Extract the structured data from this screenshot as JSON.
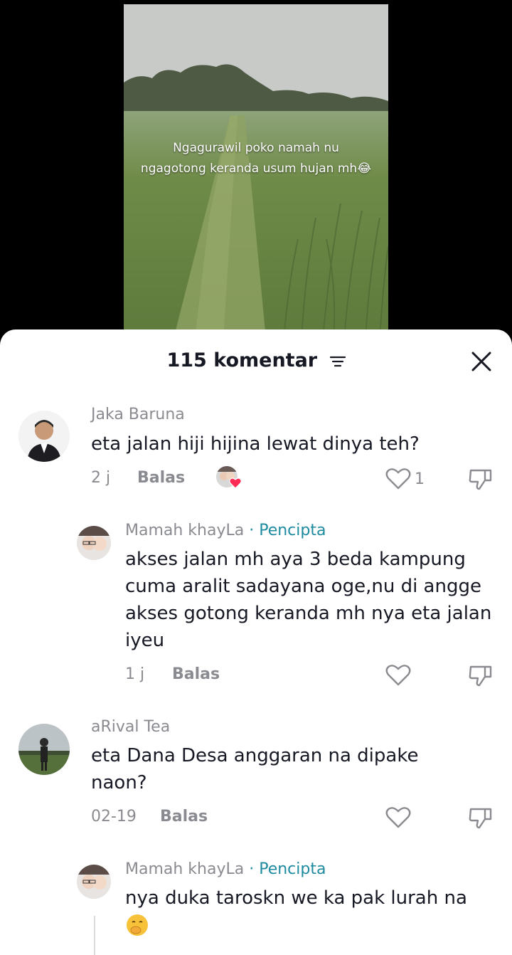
{
  "video": {
    "caption_line1": "Ngagurawil poko namah nu",
    "caption_line2": "ngagotong keranda usum hujan mh😂"
  },
  "sheet": {
    "title": "115 komentar"
  },
  "comments": [
    {
      "username": "Jaka Baruna",
      "text": "eta jalan hiji hijina lewat dinya teh?",
      "time": "2 j",
      "reply_label": "Balas",
      "likes": "1"
    },
    {
      "username": "Mamah khayLa",
      "creator_tag": "· Pencipta",
      "text": "akses jalan mh aya 3 beda kampung cuma aralit sadayana oge,nu di angge akses gotong keranda mh nya eta jalan iyeu",
      "time": "1 j",
      "reply_label": "Balas"
    },
    {
      "username": "aRival Tea",
      "text": "eta Dana Desa anggaran na dipake naon?",
      "time": "02-19",
      "reply_label": "Balas"
    },
    {
      "username": "Mamah khayLa",
      "creator_tag": "· Pencipta",
      "text": "nya duka taroskn we ka pak lurah na"
    }
  ],
  "colors": {
    "creator_tag": "#1e8ba0",
    "heart_badge": "#fe2c55",
    "text": "#161823",
    "muted": "#8a8b91"
  }
}
